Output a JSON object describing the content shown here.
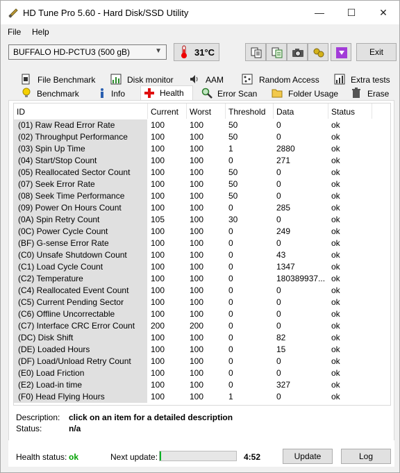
{
  "window": {
    "title": "HD Tune Pro 5.60 - Hard Disk/SSD Utility",
    "controls": {
      "minimize": "—",
      "maximize": "☐",
      "close": "✕"
    }
  },
  "menu": {
    "file": "File",
    "help": "Help"
  },
  "toolbar": {
    "drive": "BUFFALO HD-PCTU3 (500 gB)",
    "temperature": "31°C",
    "exit_label": "Exit"
  },
  "tabs_top": [
    {
      "label": "File Benchmark",
      "icon": "file-benchmark-icon"
    },
    {
      "label": "Disk monitor",
      "icon": "disk-monitor-icon"
    },
    {
      "label": "AAM",
      "icon": "speaker-icon"
    },
    {
      "label": "Random Access",
      "icon": "random-access-icon"
    },
    {
      "label": "Extra tests",
      "icon": "extra-tests-icon"
    }
  ],
  "tabs_bottom": [
    {
      "label": "Benchmark",
      "icon": "lightbulb-icon"
    },
    {
      "label": "Info",
      "icon": "info-icon"
    },
    {
      "label": "Health",
      "icon": "health-cross-icon",
      "active": true
    },
    {
      "label": "Error Scan",
      "icon": "magnifier-icon"
    },
    {
      "label": "Folder Usage",
      "icon": "folder-icon"
    },
    {
      "label": "Erase",
      "icon": "trash-icon"
    }
  ],
  "table": {
    "columns": [
      "ID",
      "Current",
      "Worst",
      "Threshold",
      "Data",
      "Status"
    ],
    "rows": [
      [
        "(01) Raw Read Error Rate",
        "100",
        "100",
        "50",
        "0",
        "ok"
      ],
      [
        "(02) Throughput Performance",
        "100",
        "100",
        "50",
        "0",
        "ok"
      ],
      [
        "(03) Spin Up Time",
        "100",
        "100",
        "1",
        "2880",
        "ok"
      ],
      [
        "(04) Start/Stop Count",
        "100",
        "100",
        "0",
        "271",
        "ok"
      ],
      [
        "(05) Reallocated Sector Count",
        "100",
        "100",
        "50",
        "0",
        "ok"
      ],
      [
        "(07) Seek Error Rate",
        "100",
        "100",
        "50",
        "0",
        "ok"
      ],
      [
        "(08) Seek Time Performance",
        "100",
        "100",
        "50",
        "0",
        "ok"
      ],
      [
        "(09) Power On Hours Count",
        "100",
        "100",
        "0",
        "285",
        "ok"
      ],
      [
        "(0A) Spin Retry Count",
        "105",
        "100",
        "30",
        "0",
        "ok"
      ],
      [
        "(0C) Power Cycle Count",
        "100",
        "100",
        "0",
        "249",
        "ok"
      ],
      [
        "(BF) G-sense Error Rate",
        "100",
        "100",
        "0",
        "0",
        "ok"
      ],
      [
        "(C0) Unsafe Shutdown Count",
        "100",
        "100",
        "0",
        "43",
        "ok"
      ],
      [
        "(C1) Load Cycle Count",
        "100",
        "100",
        "0",
        "1347",
        "ok"
      ],
      [
        "(C2) Temperature",
        "100",
        "100",
        "0",
        "180389937...",
        "ok"
      ],
      [
        "(C4) Reallocated Event Count",
        "100",
        "100",
        "0",
        "0",
        "ok"
      ],
      [
        "(C5) Current Pending Sector",
        "100",
        "100",
        "0",
        "0",
        "ok"
      ],
      [
        "(C6) Offline Uncorrectable",
        "100",
        "100",
        "0",
        "0",
        "ok"
      ],
      [
        "(C7) Interface CRC Error Count",
        "200",
        "200",
        "0",
        "0",
        "ok"
      ],
      [
        "(DC) Disk Shift",
        "100",
        "100",
        "0",
        "82",
        "ok"
      ],
      [
        "(DE) Loaded Hours",
        "100",
        "100",
        "0",
        "15",
        "ok"
      ],
      [
        "(DF) Load/Unload Retry Count",
        "100",
        "100",
        "0",
        "0",
        "ok"
      ],
      [
        "(E0) Load Friction",
        "100",
        "100",
        "0",
        "0",
        "ok"
      ],
      [
        "(E2) Load-in time",
        "100",
        "100",
        "0",
        "327",
        "ok"
      ],
      [
        "(F0) Head Flying Hours",
        "100",
        "100",
        "1",
        "0",
        "ok"
      ]
    ]
  },
  "description": {
    "desc_label": "Description:",
    "desc_value": "click on an item for a detailed description",
    "status_label": "Status:",
    "status_value": "n/a"
  },
  "footer": {
    "health_label": "Health status:",
    "health_value": "ok",
    "health_color": "#00a000",
    "next_update_label": "Next update:",
    "progress_fraction": 0.02,
    "countdown": "4:52",
    "update_label": "Update",
    "log_label": "Log"
  }
}
